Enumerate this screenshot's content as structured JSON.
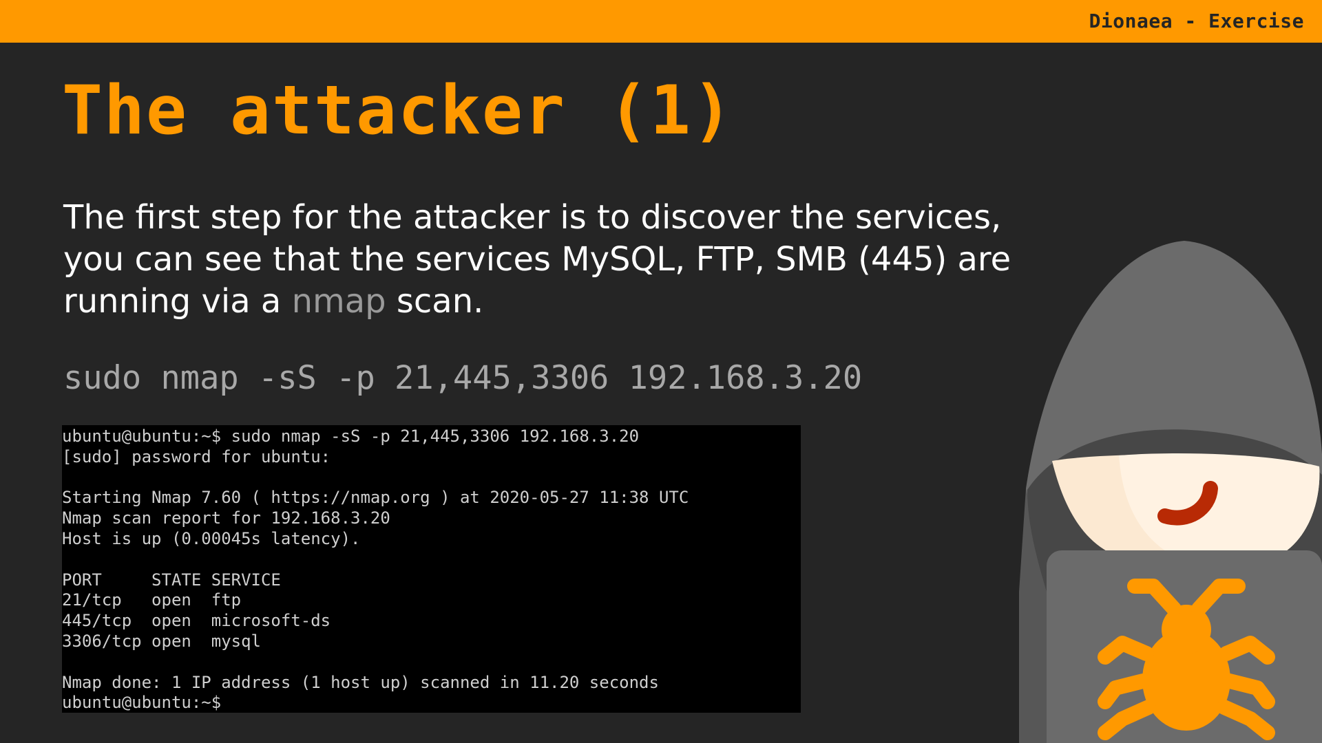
{
  "header": {
    "label": "Dionaea - Exercise"
  },
  "slide": {
    "title": "The attacker (1)",
    "paragraph": {
      "before": "The first step for the attacker is to discover the services, you can see that the services MySQL, FTP, SMB (445) are running via a ",
      "code": "nmap",
      "after": " scan."
    },
    "command": "sudo nmap -sS -p 21,445,3306 192.168.3.20"
  },
  "terminal": {
    "lines": [
      "ubuntu@ubuntu:~$ sudo nmap -sS -p 21,445,3306 192.168.3.20",
      "[sudo] password for ubuntu:",
      "",
      "Starting Nmap 7.60 ( https://nmap.org ) at 2020-05-27 11:38 UTC",
      "Nmap scan report for 192.168.3.20",
      "Host is up (0.00045s latency).",
      "",
      "PORT     STATE SERVICE",
      "21/tcp   open  ftp",
      "445/tcp  open  microsoft-ds",
      "3306/tcp open  mysql",
      "",
      "Nmap done: 1 IP address (1 host up) scanned in 11.20 seconds",
      "ubuntu@ubuntu:~$"
    ]
  },
  "illustration": {
    "icon": "hooded-hacker-with-bug-icon"
  },
  "colors": {
    "accent": "#ff9900",
    "background": "#252525",
    "text": "#ffffff",
    "muted": "#a8a8a8",
    "terminal_bg": "#000000"
  }
}
